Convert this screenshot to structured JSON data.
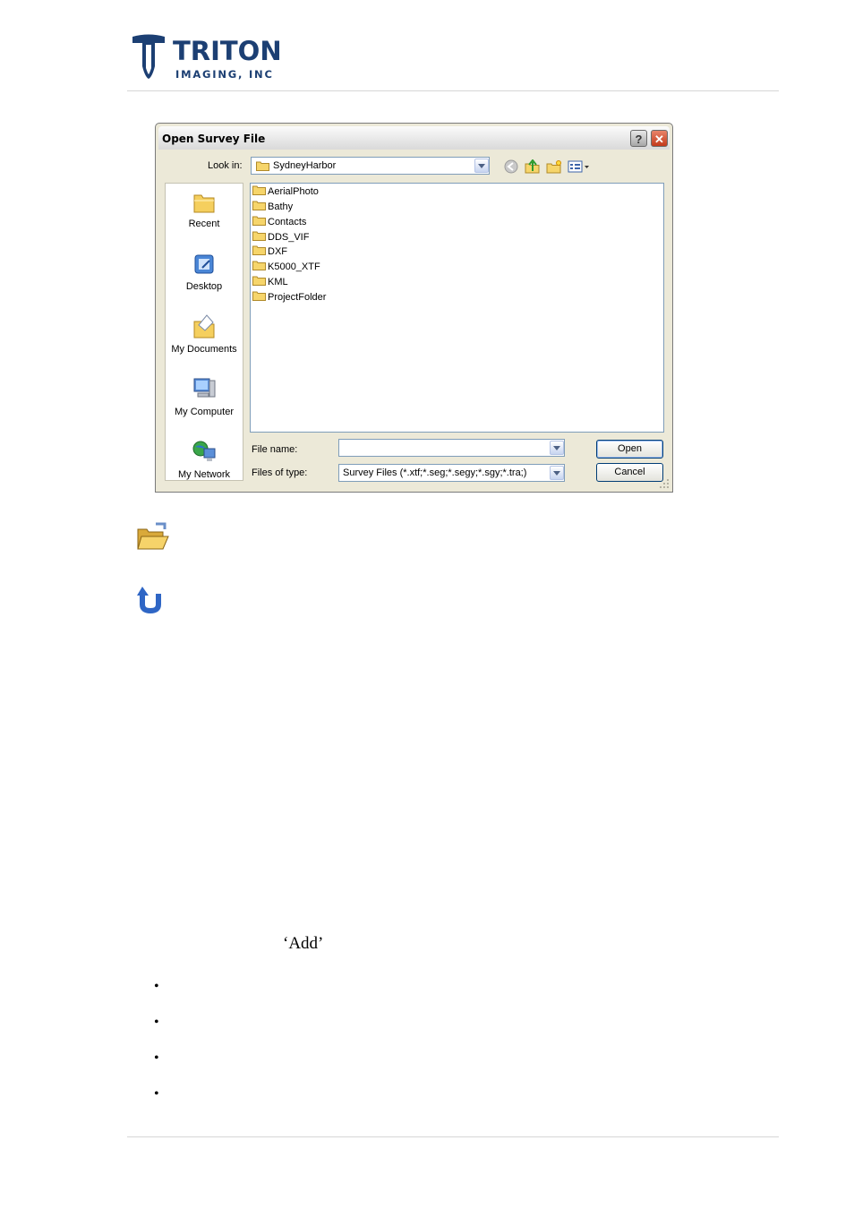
{
  "header": {
    "company_name": "TRITON",
    "company_sub": "IMAGING, INC"
  },
  "dialog": {
    "title": "Open Survey File",
    "help_label": "?",
    "close_label": "✕",
    "look_in_label": "Look in:",
    "look_in_value": "SydneyHarbor",
    "places": [
      "Recent",
      "Desktop",
      "My Documents",
      "My Computer",
      "My Network"
    ],
    "folders": [
      "AerialPhoto",
      "Bathy",
      "Contacts",
      "DDS_VIF",
      "DXF",
      "K5000_XTF",
      "KML",
      "ProjectFolder"
    ],
    "file_name_label": "File name:",
    "file_name_value": "",
    "files_of_type_label": "Files of type:",
    "files_of_type_value": "Survey Files (*.xtf;*.seg;*.segy;*.sgy;*.tra;)",
    "open_label": "Open",
    "cancel_label": "Cancel"
  },
  "body": {
    "add_text": "‘Add’",
    "bullets": [
      "•",
      "•",
      "•",
      "•"
    ]
  },
  "icons": {
    "open_folder": "open-folder-icon",
    "undo": "undo-arrow-icon"
  }
}
